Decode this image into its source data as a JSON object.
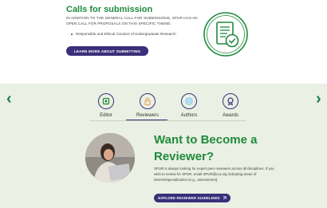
{
  "calls": {
    "title": "Calls for submission",
    "body": "IN ADDITION TO THE GENERAL CALL FOR SUBMISSIONS, SPUR HAS AN OPEN CALL FOR PROPOSALS ON THIS SPECIFIC THEME:",
    "items": [
      "Responsible and Ethical Conduct of Undergraduate Research"
    ],
    "button_label": "LEARN MORE ABOUT SUBMITTING",
    "icon": "document-check-icon"
  },
  "reviewer_panel": {
    "tabs": [
      {
        "label": "Editor",
        "icon": "editor-icon",
        "color": "#1f8a3c"
      },
      {
        "label": "Reviewers",
        "icon": "reviewer-lock-icon",
        "color": "#f2a65a",
        "active": true
      },
      {
        "label": "Authors",
        "icon": "authors-icon",
        "color": "#7fc7e6"
      },
      {
        "label": "Awards",
        "icon": "awards-icon",
        "color": "#3a2f7a"
      }
    ],
    "heading": "Want to Become a Reviewer?",
    "description": "SPUR is always looking for expert peer reviewers across all disciplines. If you wish to review for SPUR, email SPUR@cur.org indicating areas of interest/specialization (e.g., assessment).",
    "button_label": "EXPLORE REVIEWER GUIDELINES",
    "prev_arrow": "‹",
    "next_arrow": "›"
  },
  "colors": {
    "brand_green": "#1f8a3c",
    "brand_purple": "#3a2f7a",
    "panel_bg": "#eaf0e3"
  }
}
